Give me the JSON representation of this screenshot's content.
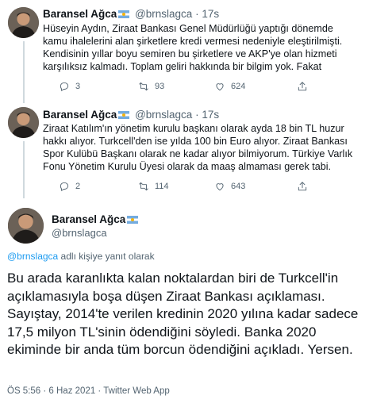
{
  "tweets": [
    {
      "name": "Baransel Ağca",
      "handle": "@brnslagca",
      "separator": "·",
      "time": "17s",
      "text": "Hüseyin Aydın, Ziraat Bankası Genel Müdürlüğü yaptığı dönemde kamu ihalelerini alan şirketlere kredi vermesi nedeniyle eleştirilmişti. Kendisinin yıllar boyu semiren bu şirketlere ve AKP'ye olan hizmeti karşılıksız kalmadı. Toplam geliri hakkında bir bilgim yok. Fakat",
      "replies": "3",
      "retweets": "93",
      "likes": "624"
    },
    {
      "name": "Baransel Ağca",
      "handle": "@brnslagca",
      "separator": "·",
      "time": "17s",
      "text": "Ziraat Katılım'ın yönetim kurulu başkanı olarak ayda 18 bin TL huzur hakkı alıyor. Turkcell'den ise yılda 100 bin Euro alıyor. Ziraat Bankası Spor Kulübü Başkanı olarak ne kadar alıyor bilmiyorum. Türkiye Varlık Fonu Yönetim Kurulu Üyesi olarak da maaş almaması gerek tabi.",
      "replies": "2",
      "retweets": "114",
      "likes": "643"
    }
  ],
  "main_tweet": {
    "name": "Baransel Ağca",
    "handle": "@brnslagca",
    "replying_mention": "@brnslagca",
    "replying_suffix": " adlı kişiye yanıt olarak",
    "text": "Bu arada karanlıkta kalan noktalardan biri de Turkcell'in açıklamasıyla boşa düşen Ziraat Bankası açıklaması. Sayıştay, 2014'te verilen kredinin 2020 yılına kadar sadece 17,5 milyon TL'sinin ödendiğini söyledi. Banka 2020 ekiminde bir anda tüm borcun ödendiğini açıkladı. Yersen.",
    "meta": "ÖS 5:56 · 6 Haz 2021 · Twitter Web App"
  },
  "icons": {
    "reply": "reply-icon",
    "retweet": "retweet-icon",
    "like": "heart-icon",
    "share": "share-icon"
  },
  "colors": {
    "link": "#1d9bf0",
    "secondary_text": "#536471",
    "thread_line": "#cfd9de"
  }
}
